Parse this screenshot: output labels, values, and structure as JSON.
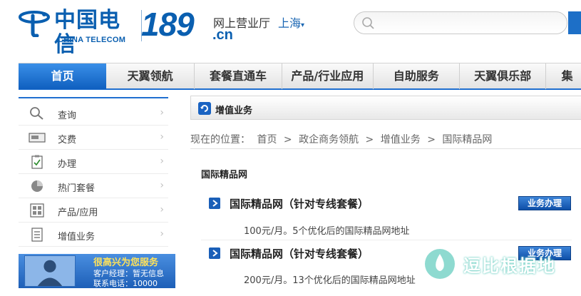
{
  "header": {
    "logo_cn": "中国电信",
    "logo_en": "CHINA TELECOM",
    "brand_number": "189",
    "brand_suffix": ".cn",
    "hall_label": "网上营业厅",
    "region": "上海",
    "search_placeholder": ""
  },
  "nav": {
    "items": [
      {
        "label": "首页",
        "active": true
      },
      {
        "label": "天翼领航"
      },
      {
        "label": "套餐直通车"
      },
      {
        "label": "产品/行业应用"
      },
      {
        "label": "自助服务"
      },
      {
        "label": "天翼俱乐部"
      },
      {
        "label": "集"
      }
    ]
  },
  "sidebar": {
    "items": [
      {
        "label": "查询",
        "icon": "magnifier-icon"
      },
      {
        "label": "交费",
        "icon": "card-icon"
      },
      {
        "label": "办理",
        "icon": "clipboard-icon"
      },
      {
        "label": "热门套餐",
        "icon": "pie-icon"
      },
      {
        "label": "产品/应用",
        "icon": "grid-icon"
      },
      {
        "label": "增值业务",
        "icon": "list-icon"
      }
    ],
    "arrow": "›",
    "manager": {
      "title": "很高兴为您服务",
      "line1": "客户经理：暂无信息",
      "line2": "联系电话：10000"
    }
  },
  "main": {
    "panel_title": "增值业务",
    "breadcrumb": {
      "prefix": "现在的位置：",
      "items": [
        "首页",
        "政企商务领航",
        "增值业务",
        "国际精品网"
      ],
      "separator": ">"
    },
    "section_title": "国际精品网",
    "packages": [
      {
        "title": "国际精品网（针对专线套餐）",
        "desc": "100元/月。5个优化后的国际精品网地址",
        "button": "业务办理"
      },
      {
        "title": "国际精品网（针对专线套餐）",
        "desc": "200元/月。13个优化后的国际精品网地址",
        "button": "业务办理"
      }
    ]
  },
  "watermark": {
    "text": "逗比根据地"
  },
  "colors": {
    "brand_blue": "#0a5fb0",
    "nav_active": "#1f6fd0",
    "button_blue": "#1d5fb7"
  }
}
